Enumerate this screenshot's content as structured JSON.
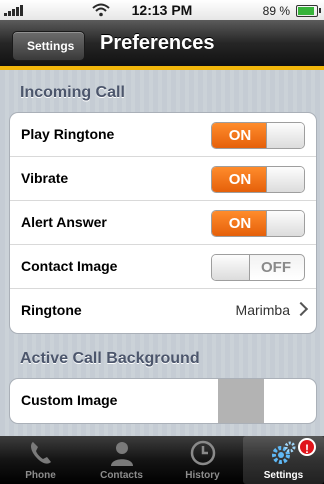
{
  "status": {
    "time": "12:13 PM",
    "battery_text": "89 %",
    "battery_level": 0.89
  },
  "nav": {
    "back_label": "Settings",
    "title": "Preferences"
  },
  "sections": [
    {
      "header": "Incoming Call",
      "rows": [
        {
          "label": "Play Ringtone",
          "toggle": "ON"
        },
        {
          "label": "Vibrate",
          "toggle": "ON"
        },
        {
          "label": "Alert Answer",
          "toggle": "ON"
        },
        {
          "label": "Contact Image",
          "toggle": "OFF"
        },
        {
          "label": "Ringtone",
          "value": "Marimba"
        }
      ]
    },
    {
      "header": "Active Call Background",
      "rows": [
        {
          "label": "Custom Image"
        }
      ]
    }
  ],
  "tabs": [
    {
      "label": "Phone",
      "icon": "phone-handset-icon"
    },
    {
      "label": "Contacts",
      "icon": "person-icon"
    },
    {
      "label": "History",
      "icon": "clock-icon"
    },
    {
      "label": "Settings",
      "icon": "gears-icon",
      "selected": true,
      "badge": "!"
    }
  ],
  "colors": {
    "accent": "#f1b60c",
    "switch_on": "#f26d12",
    "section_header": "#4c566c"
  }
}
